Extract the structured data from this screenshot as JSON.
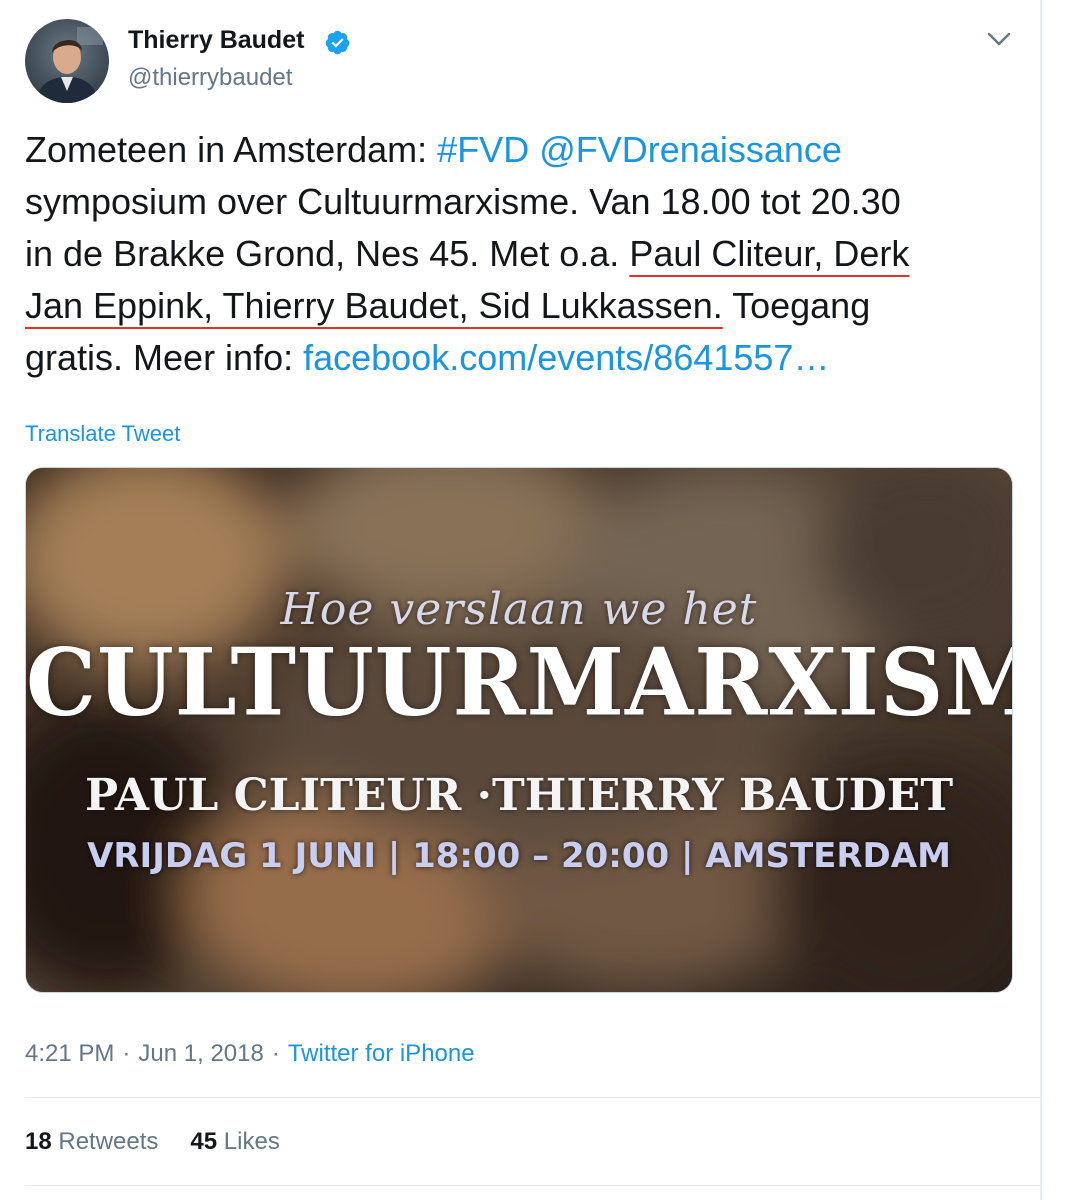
{
  "author": {
    "name": "Thierry Baudet",
    "handle": "@thierrybaudet",
    "verified": true
  },
  "tweet": {
    "line1": {
      "prefix": "Zometeen in Amsterdam: ",
      "hashtag": "#FVD",
      "space": " ",
      "mention": "@FVDrenaissance"
    },
    "line2": "symposium over Cultuurmarxisme. Van 18.00 tot 20.30",
    "line3": {
      "prefix": "in de Brakke Grond, Nes 45. Met o.a. ",
      "underlined": "Paul Cliteur, Derk"
    },
    "line4": {
      "underlined": "Jan Eppink, Thierry Baudet, Sid Lukkassen.",
      "suffix": " Toegang"
    },
    "line5": {
      "prefix": "gratis. Meer info: ",
      "link": "facebook.com/events/8641557…"
    }
  },
  "translate_label": "Translate Tweet",
  "media": {
    "subtitle": "Hoe verslaan we het",
    "title": "CULTUURMARXISME",
    "speakers": "PAUL CLITEUR ·THIERRY BAUDET",
    "details": "VRIJDAG 1 JUNI | 18:00 – 20:00 | AMSTERDAM"
  },
  "meta": {
    "time": "4:21 PM",
    "dot": "·",
    "date": "Jun 1, 2018",
    "source": "Twitter for iPhone"
  },
  "stats": {
    "retweets_count": "18",
    "retweets_label": "Retweets",
    "likes_count": "45",
    "likes_label": "Likes"
  },
  "colors": {
    "link": "#1b95e0",
    "secondary_text": "#657786",
    "underline_annotation": "#e0332a"
  }
}
